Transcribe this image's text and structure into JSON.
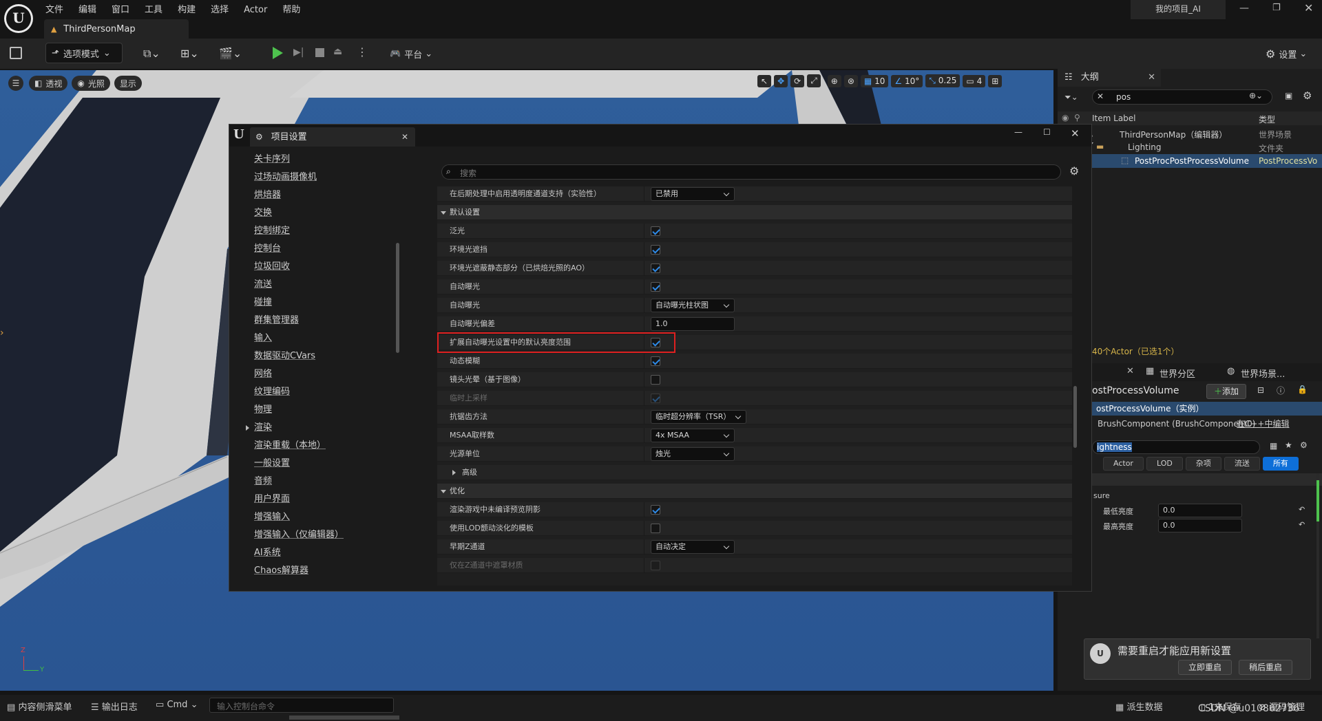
{
  "menu": {
    "items": [
      "文件",
      "编辑",
      "窗口",
      "工具",
      "构建",
      "选择",
      "Actor",
      "帮助"
    ]
  },
  "project_name": "我的项目_AI",
  "map_tab": "ThirdPersonMap",
  "toolbar": {
    "mode": "选项模式",
    "platform": "平台",
    "settings": "设置"
  },
  "viewport": {
    "btn_perspective": "透视",
    "btn_lit": "光照",
    "btn_show": "显示",
    "grid_value": "10",
    "angle_value": "10°",
    "scale_value": "0.25",
    "camera_speed": "4",
    "axis_z": "Z",
    "axis_y": "Y"
  },
  "outliner": {
    "title": "大纲",
    "search_value": "pos",
    "col_label": "Item Label",
    "col_type": "类型",
    "rows": [
      {
        "label": "ThirdPersonMap（编辑器）",
        "type": "世界场景"
      },
      {
        "label": "Lighting",
        "type": "文件夹"
      },
      {
        "label": "PostProcPostProcessVolume",
        "type": "PostProcessVo"
      }
    ],
    "count": "40个Actor（已选1个）"
  },
  "details": {
    "tab_world_partition": "世界分区",
    "tab_world_scene": "世界场景...",
    "object_name": "ostProcessVolume",
    "add_button": "添加",
    "instance_label": "ostProcessVolume（实例）",
    "component": "BrushComponent (BrushComponent0)",
    "edit_cpp": "在C++中编辑",
    "search_value": "ightness",
    "filters": [
      "Actor",
      "LOD",
      "杂项",
      "流送",
      "所有"
    ],
    "section": "sure",
    "min_brightness_label": "最低亮度",
    "min_brightness_value": "0.0",
    "max_brightness_label": "最高亮度",
    "max_brightness_value": "0.0"
  },
  "settings_window": {
    "title": "项目设置",
    "search_placeholder": "搜索",
    "nav": [
      "关卡序列",
      "过场动画摄像机",
      "烘焙器",
      "交换",
      "控制绑定",
      "控制台",
      "垃圾回收",
      "流送",
      "碰撞",
      "群集管理器",
      "输入",
      "数据驱动CVars",
      "网络",
      "纹理编码",
      "物理",
      "渲染",
      "渲染重载（本地）",
      "一般设置",
      "音频",
      "用户界面",
      "增强输入",
      "增强输入（仅编辑器）",
      "AI系统",
      "Chaos解算器"
    ],
    "top_row": {
      "label": "在后期处理中启用透明度通道支持（实验性）",
      "value": "已禁用"
    },
    "cat_defaults": "默认设置",
    "rows": [
      {
        "label": "泛光",
        "kind": "check",
        "checked": true
      },
      {
        "label": "环境光遮挡",
        "kind": "check",
        "checked": true
      },
      {
        "label": "环境光遮蔽静态部分（已烘焙光照的AO）",
        "kind": "check",
        "checked": true
      },
      {
        "label": "自动曝光",
        "kind": "check",
        "checked": true
      },
      {
        "label": "自动曝光",
        "kind": "combo",
        "value": "自动曝光柱状图"
      },
      {
        "label": "自动曝光偏差",
        "kind": "num",
        "value": "1.0"
      },
      {
        "label": "扩展自动曝光设置中的默认亮度范围",
        "kind": "check",
        "checked": true,
        "highlight": true
      },
      {
        "label": "动态模糊",
        "kind": "check",
        "checked": true
      },
      {
        "label": "镜头光晕（基于图像）",
        "kind": "check",
        "checked": false
      },
      {
        "label": "临时上采样",
        "kind": "check",
        "checked": true,
        "disabled": true
      },
      {
        "label": "抗锯齿方法",
        "kind": "combo",
        "value": "临时超分辨率（TSR）"
      },
      {
        "label": "MSAA取样数",
        "kind": "combo",
        "value": "4x MSAA"
      },
      {
        "label": "光源单位",
        "kind": "combo",
        "value": "烛光"
      }
    ],
    "advanced": "高级",
    "cat_optimization": "优化",
    "opt_rows": [
      {
        "label": "渲染游戏中未编译预览阴影",
        "kind": "check",
        "checked": true
      },
      {
        "label": "使用LOD颤动淡化的模板",
        "kind": "check",
        "checked": false
      },
      {
        "label": "早期Z通道",
        "kind": "combo",
        "value": "自动决定"
      },
      {
        "label": "仅在Z通道中遮罩材质",
        "kind": "check",
        "checked": false,
        "disabled": true
      }
    ]
  },
  "notification": {
    "text": "需要重启才能应用新设置",
    "restart_now": "立即重启",
    "restart_later": "稍后重启"
  },
  "statusbar": {
    "content_drawer": "内容侧滑菜单",
    "output_log": "输出日志",
    "cmd": "Cmd",
    "console_placeholder": "输入控制台命令",
    "derived_data": "派生数据",
    "unsaved": "1未保存",
    "source_control": "源码管理",
    "watermark": "CSDN @u010862736"
  }
}
